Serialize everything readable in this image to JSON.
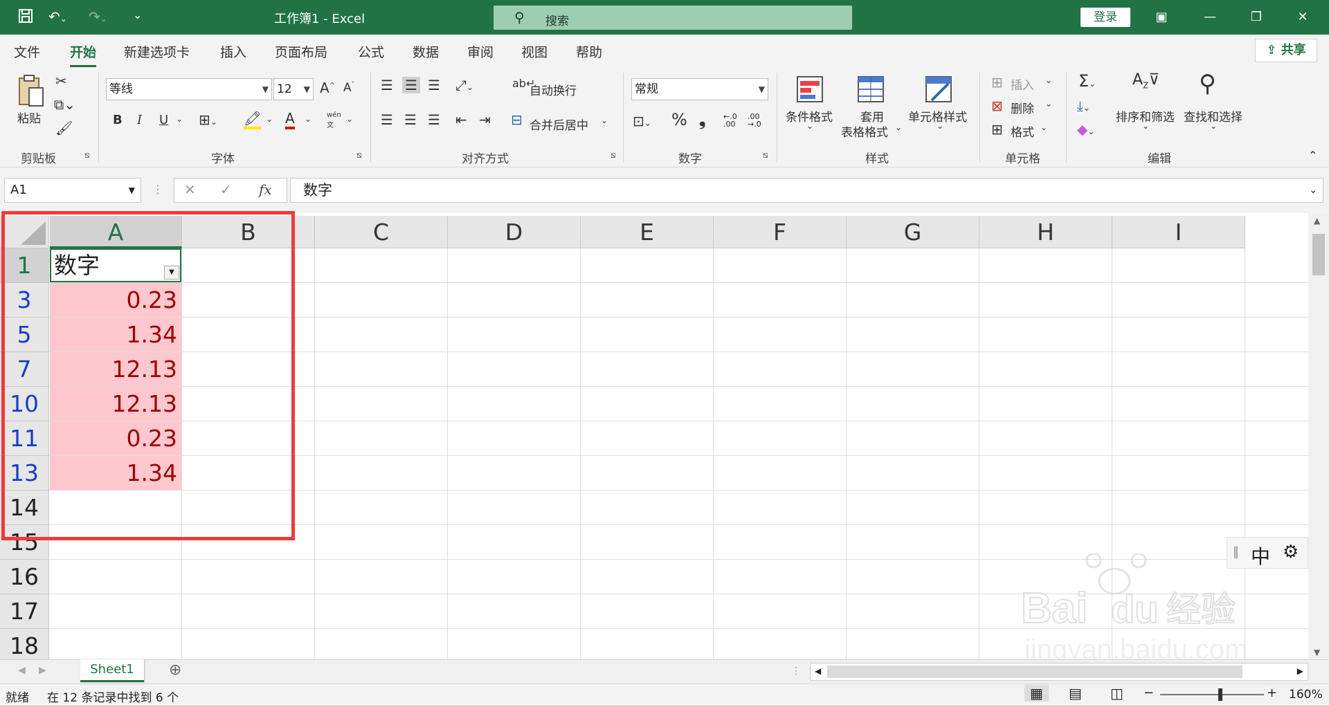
{
  "titlebar": {
    "title": "工作簿1  -  Excel",
    "search_placeholder": "搜索",
    "login": "登录"
  },
  "menu": {
    "tabs": [
      "文件",
      "开始",
      "新建选项卡",
      "插入",
      "页面布局",
      "公式",
      "数据",
      "审阅",
      "视图",
      "帮助"
    ],
    "active_tab": "开始",
    "share": "共享"
  },
  "ribbon": {
    "clipboard": {
      "paste": "粘贴",
      "group": "剪贴板"
    },
    "font": {
      "name": "等线",
      "size": "12",
      "bold": "B",
      "italic": "I",
      "underline": "U",
      "wen": "wén",
      "wen_sub": "文",
      "group": "字体"
    },
    "alignment": {
      "wrap": "自动换行",
      "merge": "合并后居中",
      "group": "对齐方式"
    },
    "number": {
      "format": "常规",
      "percent": "%",
      "comma": "❟",
      "group": "数字"
    },
    "styles": {
      "conditional": "条件格式",
      "table1": "套用",
      "table2": "表格格式",
      "cell_styles": "单元格样式",
      "group": "样式"
    },
    "cells": {
      "insert": "插入",
      "delete": "删除",
      "format": "格式",
      "group": "单元格"
    },
    "editing": {
      "sort": "排序和筛选",
      "find": "查找和选择",
      "group": "编辑"
    }
  },
  "formula_bar": {
    "name_box": "A1",
    "fx": "fx",
    "value": "数字"
  },
  "sheet": {
    "columns": [
      "A",
      "B",
      "C",
      "D",
      "E",
      "F",
      "G",
      "H",
      "I"
    ],
    "rows": [
      "1",
      "3",
      "5",
      "7",
      "10",
      "11",
      "13",
      "14",
      "15",
      "16",
      "17",
      "18"
    ],
    "header_cell": "数字",
    "values": [
      "0.23",
      "1.34",
      "12.13",
      "12.13",
      "0.23",
      "1.34"
    ]
  },
  "ime": {
    "mode": "中"
  },
  "sheet_tabs": {
    "active": "Sheet1"
  },
  "status": {
    "ready": "就绪",
    "message": "在 12 条记录中找到 6 个",
    "zoom": "160%"
  },
  "watermark": {
    "brand": "Bai",
    "brand2": "du",
    "cn": "经验",
    "url": "jingyan.baidu.com"
  },
  "colors": {
    "excel_green": "#217346",
    "bad_fill": "#ffc7ce",
    "bad_text": "#9c0006",
    "highlight_box": "#ef3b3b",
    "filter_row": "#1a3cc8"
  }
}
